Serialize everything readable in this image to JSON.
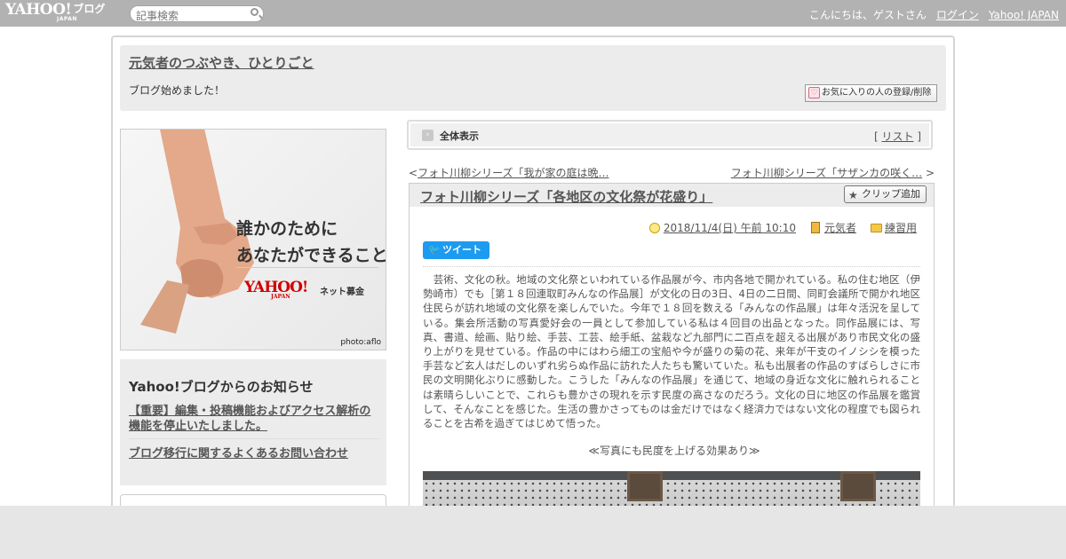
{
  "topbar": {
    "logo_text": "YAHOO!",
    "logo_sub": "JAPAN",
    "service_name": "ブログ",
    "search_placeholder": "記事検索",
    "greeting": "こんにちは、ゲストさん",
    "login_label": "ログイン",
    "yahoo_japan_label": "Yahoo! JAPAN"
  },
  "blog": {
    "title": "元気者のつぶやき、ひとりごと",
    "description": "ブログ始めました！",
    "favorite_button": "お気に入りの人の登録/削除"
  },
  "banner": {
    "line1": "誰かのために",
    "line2": "あなたができること",
    "logo": "YAHOO!",
    "logo_sub": "JAPAN",
    "service": "ネット募金",
    "credit": "photo:aflo"
  },
  "notice": {
    "heading": "Yahoo!ブログからのお知らせ",
    "item1": "【重要】編集・投稿機能およびアクセス解析の機能を停止いたしました。",
    "item2": "ブログ移行に関するよくあるお問い合わせ"
  },
  "tabbar": {
    "view_all": "全体表示",
    "bracket_open": "[",
    "list_label": "リスト",
    "bracket_close": "]"
  },
  "nav": {
    "prev_arrow": "<",
    "prev_title": "フォト川柳シリーズ「我が家の庭は晩…",
    "next_title": "フォト川柳シリーズ「サザンカの咲く…",
    "next_arrow": ">"
  },
  "article": {
    "title": "フォト川柳シリーズ「各地区の文化祭が花盛り」",
    "clip_button": "クリップ追加",
    "datetime": "2018/11/4(日) 午前 10:10",
    "author": "元気者",
    "category": "練習用",
    "tweet_button": "ツイート",
    "body": "　芸術、文化の秋。地域の文化祭といわれている作品展が今、市内各地で開かれている。私の住む地区（伊勢崎市）でも［第１８回連取町みんなの作品展］が文化の日の3日、4日の二日間、同町会議所で開かれ地区住民らが訪れ地域の文化祭を楽しんでいた。今年で１８回を数える「みんなの作品展」は年々活況を呈している。集会所活動の写真愛好会の一員として参加している私は４回目の出品となった。同作品展には、写真、書道、絵画、貼り絵、手芸、工芸、絵手紙、盆栽など九部門に二百点を超える出展があり市民文化の盛り上がりを見せている。作品の中にはわら細工の宝船や今が盛りの菊の花、来年が干支のイノシシを模った手芸など玄人はだしのいずれ劣らぬ作品に訪れた人たちも驚いていた。私も出展者の作品のすばらしさに市民の文明開化ぶりに感動した。こうした「みんなの作品展」を通じて、地域の身近な文化に触れられることは素晴らしいことで、これらも豊かさの現れを示す民度の高さなのだろう。文化の日に地区の作品展を鑑賞して、そんなことを感じた。生活の豊かさってものは金だけではなく経済力ではない文化の程度でも図られることを古希を過ぎてはじめて悟った。",
    "caption": "≪写真にも民度を上げる効果あり≫"
  },
  "colors": {
    "topbar": "#b2b2b2",
    "panel": "#ececec",
    "link": "#555555",
    "tweet": "#1d9bf0",
    "banner_logo": "#d20000"
  }
}
